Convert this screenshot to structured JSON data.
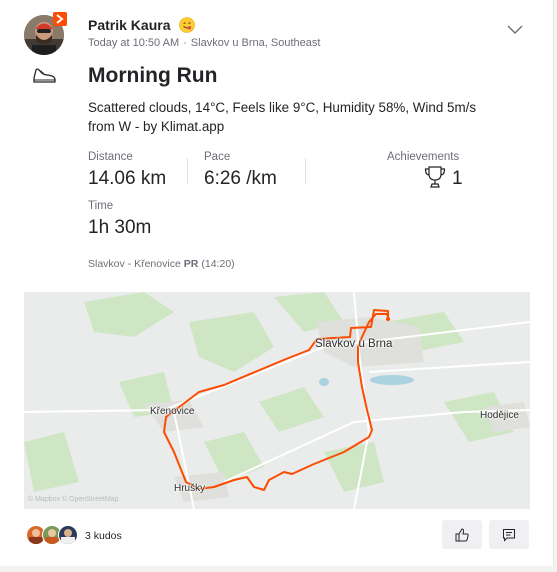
{
  "athlete": {
    "name": "Patrik Kaura",
    "emoji": "savoring-face-emoji",
    "avatar_icon": "cyclist-avatar",
    "badge_icon": "subscriber-chevron-badge"
  },
  "activity_meta": {
    "time": "Today at 10:50 AM",
    "separator": "·",
    "location": "Slavkov u Brna, Southeast"
  },
  "activity": {
    "sport_icon": "run-shoe-icon",
    "title": "Morning Run",
    "description": "Scattered clouds, 14°C, Feels like 9°C, Humidity 58%, Wind 5m/s from W - by Klimat.app"
  },
  "stats": {
    "distance": {
      "label": "Distance",
      "value": "14.06 km"
    },
    "pace": {
      "label": "Pace",
      "value": "6:26 /km"
    },
    "time": {
      "label": "Time",
      "value": "1h 30m"
    },
    "achievements": {
      "label": "Achievements",
      "value": "1",
      "icon": "trophy-icon"
    }
  },
  "segment": {
    "name": "Slavkov - Křenovice",
    "badge": "PR",
    "time": "(14:20)"
  },
  "map": {
    "labels": {
      "slavkov": "Slavkov u Brna",
      "krenovice": "Křenovice",
      "hodejice": "Hodějice",
      "hrusky": "Hrušky"
    },
    "watermark": "© Mapbox © OpenStreetMap",
    "route_color": "#fc4c02",
    "water_color": "#aad3df",
    "forest_color": "#cfe6c4"
  },
  "kudos": {
    "count_label": "3 kudos",
    "avatars": [
      "kudo-avatar-1",
      "kudo-avatar-2",
      "kudo-avatar-3"
    ]
  },
  "actions": {
    "kudos_button_icon": "thumbs-up-icon",
    "comment_button_icon": "comment-icon"
  },
  "colors": {
    "brand": "#fc4c02",
    "text": "#242428",
    "muted": "#6d6d78"
  }
}
